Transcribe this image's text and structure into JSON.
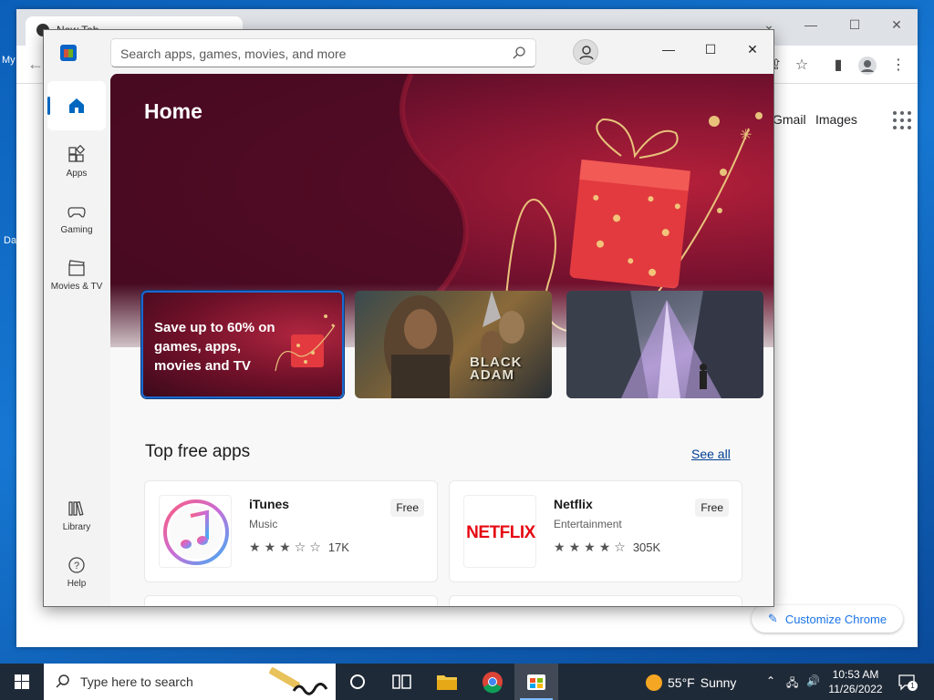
{
  "desktop": {
    "icon_labels": [
      "My",
      "Da"
    ]
  },
  "chrome": {
    "tab_title": "New Tab",
    "links": {
      "gmail": "Gmail",
      "images": "Images"
    },
    "customize_label": "Customize Chrome"
  },
  "store": {
    "search": {
      "placeholder": "Search apps, games, movies, and more"
    },
    "nav": [
      {
        "id": "home",
        "label": "",
        "icon": "home-icon"
      },
      {
        "id": "apps",
        "label": "Apps",
        "icon": "apps-icon"
      },
      {
        "id": "gaming",
        "label": "Gaming",
        "icon": "controller-icon"
      },
      {
        "id": "movies",
        "label": "Movies & TV",
        "icon": "clapperboard-icon"
      },
      {
        "id": "library",
        "label": "Library",
        "icon": "library-icon"
      },
      {
        "id": "help",
        "label": "Help",
        "icon": "help-icon"
      }
    ],
    "hero": {
      "title": "Home"
    },
    "cards": [
      {
        "text": "Save up to 60% on games, apps, movies and TV"
      },
      {
        "text": "BLACK ADAM"
      },
      {
        "text": ""
      }
    ],
    "section": {
      "title": "Top free apps",
      "see_all": "See all"
    },
    "apps": [
      {
        "name": "iTunes",
        "category": "Music",
        "price": "Free",
        "rating": 3,
        "reviews": "17K"
      },
      {
        "name": "Netflix",
        "category": "Entertainment",
        "price": "Free",
        "rating": 4,
        "reviews": "305K"
      }
    ],
    "colors": {
      "accent": "#0067c0",
      "hero": "#7a1230"
    }
  },
  "taskbar": {
    "search_placeholder": "Type here to search",
    "weather": {
      "temp": "55°F",
      "condition": "Sunny"
    },
    "clock": {
      "time": "10:53 AM",
      "date": "11/26/2022"
    },
    "notifications": "1"
  }
}
